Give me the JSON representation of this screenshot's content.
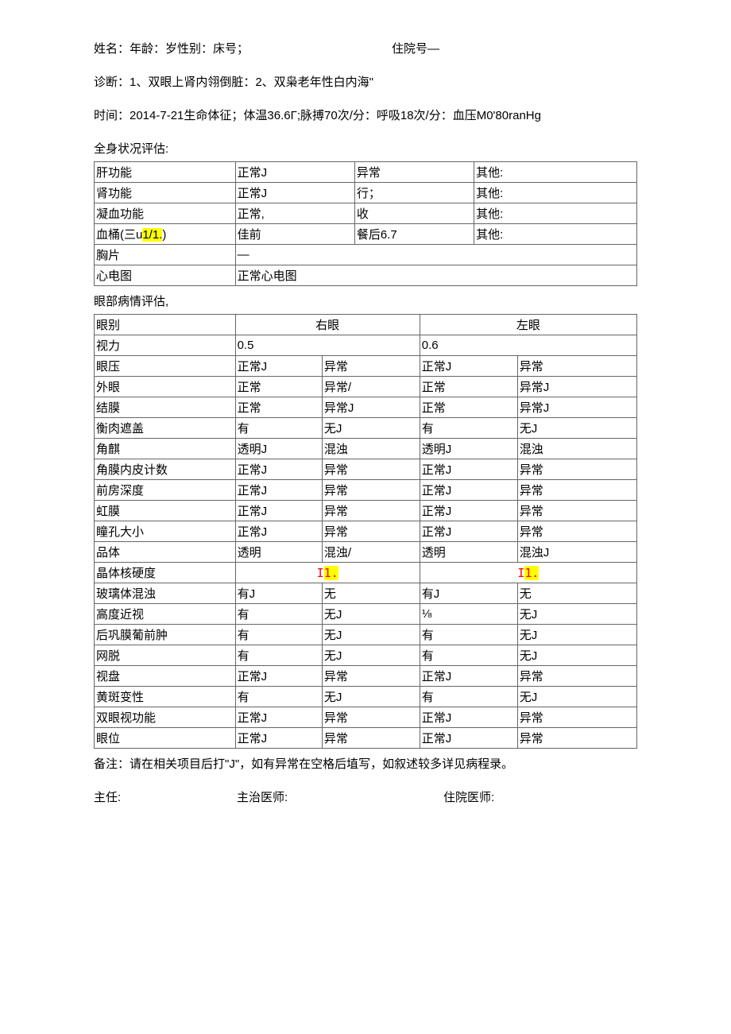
{
  "header": {
    "patient_line_left": "姓名：年龄：岁性别：床号；",
    "patient_line_right": "住院号—",
    "diagnosis": "诊断：1、双眼上肾内翎倒脏：2、双枭老年性白内海\"",
    "vitals": "时间：2014-7-21生命体征；体温36.6Γ;脉搏70次/分：呼吸18次/分：血压M0'80ranHg"
  },
  "systemic_title": "全身状况评估:",
  "systemic_rows": [
    {
      "label": "肝功能",
      "c1": "正常J",
      "c2": "异常",
      "c3": "其他:"
    },
    {
      "label": "肾功能",
      "c1": "正常J",
      "c2": "行；",
      "c3": "其他:"
    },
    {
      "label": "凝血功能",
      "c1": "正常,",
      "c2": "收",
      "c3": "其他:"
    },
    {
      "label_pre": "血桶(三u",
      "label_hl": "1/1.",
      "label_post": ")",
      "c1": "佳前",
      "c2": "餐后6.7",
      "c3": "其他:"
    }
  ],
  "systemic_wide": [
    {
      "label": "胸片",
      "val": "—"
    },
    {
      "label": "心电图",
      "val": "正常心电图"
    }
  ],
  "eye_title": "眼部病情评估,",
  "eye_header": {
    "label": "眼别",
    "right": "右眼",
    "left": "左眼"
  },
  "eye_vision": {
    "label": "视力",
    "right": "0.5",
    "left": "0.6"
  },
  "eye_rows": [
    {
      "label": "眼压",
      "r1": "正常J",
      "r2": "异常",
      "l1": "正常J",
      "l2": "异常"
    },
    {
      "label": "外眼",
      "r1": "正常",
      "r2": "异常/",
      "l1": "正常",
      "l2": "异常J"
    },
    {
      "label": "结膜",
      "r1": "正常",
      "r2": "异常J",
      "l1": "正常",
      "l2": "异常J"
    },
    {
      "label": "衡肉遮盖",
      "r1": "有",
      "r2": "无J",
      "l1": "有",
      "l2": "无J"
    },
    {
      "label": "角麒",
      "r1": "透明J",
      "r2": "混浊",
      "l1": "透明J",
      "l2": "混浊"
    },
    {
      "label": "角膜内皮计数",
      "r1": "正常J",
      "r2": "异常",
      "l1": "正常J",
      "l2": "异常"
    },
    {
      "label": "前房深度",
      "r1": "正常J",
      "r2": "异常",
      "l1": "正常J",
      "l2": "异常"
    },
    {
      "label": "虹膜",
      "r1": "正常J",
      "r2": "异常",
      "l1": "正常J",
      "l2": "异常"
    },
    {
      "label": "瞳孔大小",
      "r1": "正常J",
      "r2": "异常",
      "l1": "正常J",
      "l2": "异常"
    },
    {
      "label": "品体",
      "r1": "透明",
      "r2": "混浊/",
      "l1": "透明",
      "l2": "混浊J"
    }
  ],
  "nucleus": {
    "label": "晶体核硬度",
    "r_pre": "I",
    "r_hl": "1.",
    "l_pre": "I",
    "l_hl": "1."
  },
  "eye_rows2": [
    {
      "label": "玻璃体混浊",
      "r1": "有J",
      "r2": "无",
      "l1": "有J",
      "l2": "无"
    },
    {
      "label": "高度近视",
      "r1": "有",
      "r2": "无J",
      "l1": "⅛",
      "l2": "无J"
    },
    {
      "label": "后巩膜葡前肿",
      "r1": "有",
      "r2": "无J",
      "l1": "有",
      "l2": "无J"
    },
    {
      "label": "网脱",
      "r1": "有",
      "r2": "无J",
      "l1": "有",
      "l2": "无J"
    },
    {
      "label": "视盘",
      "r1": "正常J",
      "r2": "异常",
      "l1": "正常J",
      "l2": "异常"
    },
    {
      "label": "黄斑变性",
      "r1": "有",
      "r2": "无J",
      "l1": "有",
      "l2": "无J"
    },
    {
      "label": "双眼视功能",
      "r1": "正常J",
      "r2": "异常",
      "l1": "正常J",
      "l2": "异常"
    },
    {
      "label": "眼位",
      "r1": "正常J",
      "r2": "异常",
      "l1": "正常J",
      "l2": "异常"
    }
  ],
  "note": "备注：请在相关项目后打\"J\"，如有异常在空格后埴写，如叙述较多详见病程录。",
  "sign": {
    "a": "主任:",
    "b": "主治医师:",
    "c": "住院医师:"
  }
}
